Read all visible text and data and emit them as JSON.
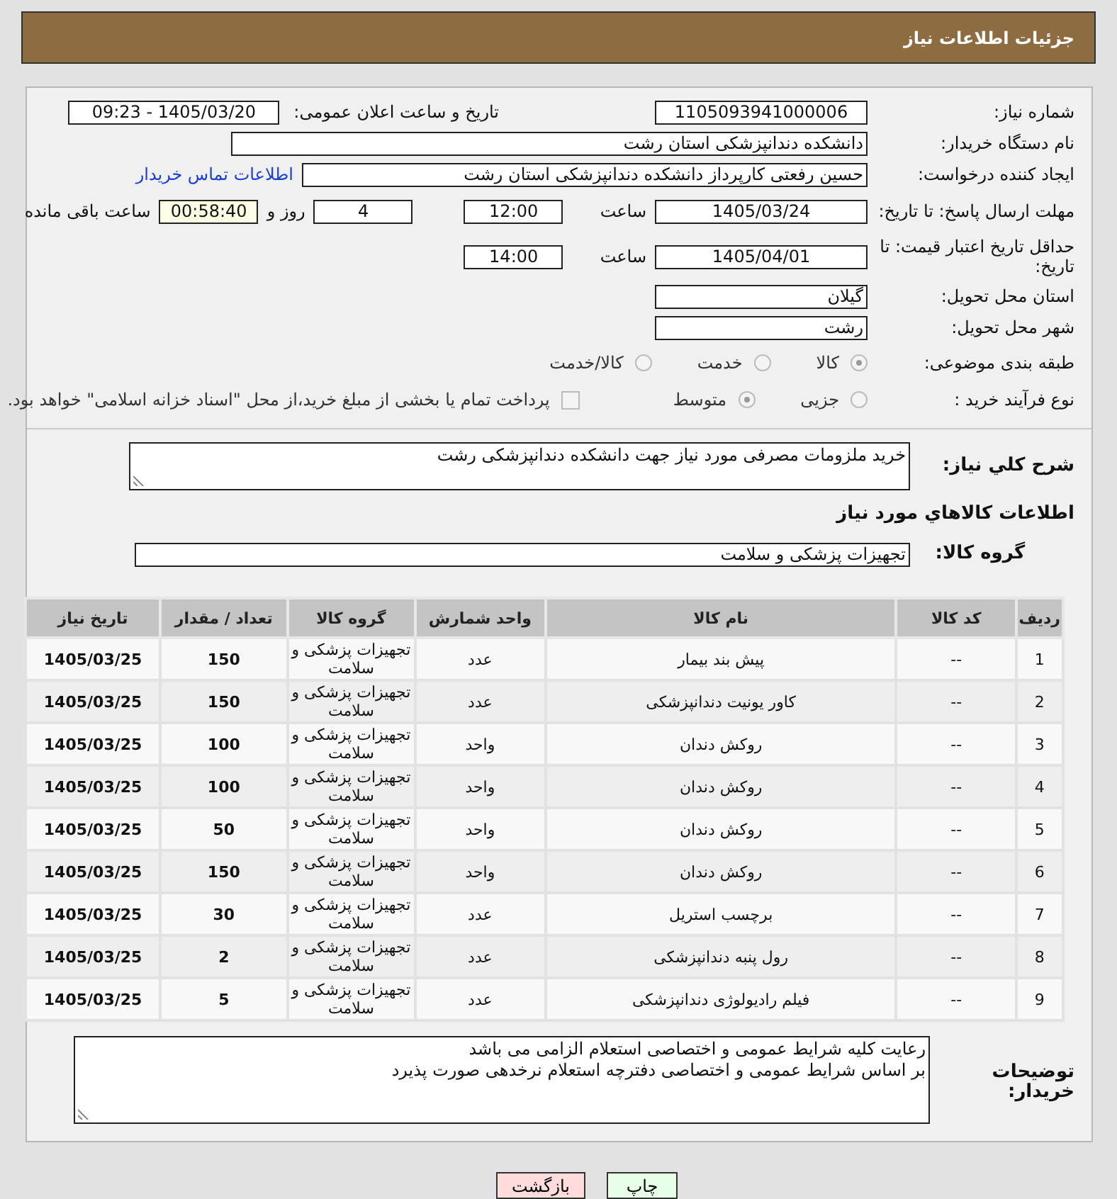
{
  "header": {
    "title": "جزئیات اطلاعات نیاز"
  },
  "need_number": {
    "label": "شماره نیاز:",
    "value": "1105093941000006"
  },
  "announce": {
    "label": "تاریخ و ساعت اعلان عمومی:",
    "value": "1405/03/20 - 09:23"
  },
  "buyer": {
    "label": "نام دستگاه خریدار:",
    "value": "دانشکده دندانپزشکی استان رشت"
  },
  "requester": {
    "label": "ایجاد کننده درخواست:",
    "value": "حسین رفعتی کارپرداز دانشکده دندانپزشکی استان رشت",
    "link": "اطلاعات تماس خریدار"
  },
  "deadline": {
    "label": "مهلت ارسال پاسخ: تا تاریخ:",
    "date": "1405/03/24",
    "time_label": "ساعت",
    "time": "12:00",
    "days": "4",
    "days_label": "روز و",
    "remaining": "00:58:40",
    "remaining_label": "ساعت باقی مانده"
  },
  "validity": {
    "label": "حداقل تاریخ اعتبار قیمت: تا تاریخ:",
    "date": "1405/04/01",
    "time_label": "ساعت",
    "time": "14:00"
  },
  "province": {
    "label": "استان محل تحویل:",
    "value": "گیلان"
  },
  "city": {
    "label": "شهر محل تحویل:",
    "value": "رشت"
  },
  "category": {
    "label": "طبقه بندی موضوعی:",
    "options": [
      {
        "label": "کالا",
        "selected": true
      },
      {
        "label": "خدمت",
        "selected": false
      },
      {
        "label": "کالا/خدمت",
        "selected": false
      }
    ]
  },
  "process": {
    "label": "نوع فرآیند خرید :",
    "options": [
      {
        "label": "جزیی",
        "selected": false
      },
      {
        "label": "متوسط",
        "selected": true
      }
    ],
    "payment": {
      "label": "پرداخت تمام یا بخشی از مبلغ خرید،از محل \"اسناد خزانه اسلامی\" خواهد بود.",
      "checked": false
    }
  },
  "description": {
    "label": "شرح کلي نياز:",
    "value": "خرید ملزومات مصرفی مورد نیاز جهت دانشکده دندانپزشکی رشت"
  },
  "goods_title": "اطلاعات کالاهاي مورد نياز",
  "group": {
    "label": "گروه کالا:",
    "value": "تجهیزات پزشکی و سلامت"
  },
  "table": {
    "columns": [
      "ردیف",
      "کد کالا",
      "نام کالا",
      "واحد شمارش",
      "گروه کالا",
      "تعداد / مقدار",
      "تاریخ نیاز"
    ],
    "rows": [
      [
        "1",
        "--",
        "پیش بند بیمار",
        "عدد",
        "تجهیزات پزشکی و سلامت",
        "150",
        "1405/03/25"
      ],
      [
        "2",
        "--",
        "کاور یونیت دندانپزشکی",
        "عدد",
        "تجهیزات پزشکی و سلامت",
        "150",
        "1405/03/25"
      ],
      [
        "3",
        "--",
        "روکش دندان",
        "واحد",
        "تجهیزات پزشکی و سلامت",
        "100",
        "1405/03/25"
      ],
      [
        "4",
        "--",
        "روکش دندان",
        "واحد",
        "تجهیزات پزشکی و سلامت",
        "100",
        "1405/03/25"
      ],
      [
        "5",
        "--",
        "روکش دندان",
        "واحد",
        "تجهیزات پزشکی و سلامت",
        "50",
        "1405/03/25"
      ],
      [
        "6",
        "--",
        "روکش دندان",
        "واحد",
        "تجهیزات پزشکی و سلامت",
        "150",
        "1405/03/25"
      ],
      [
        "7",
        "--",
        "برچسب استریل",
        "عدد",
        "تجهیزات پزشکی و سلامت",
        "30",
        "1405/03/25"
      ],
      [
        "8",
        "--",
        "رول پنبه دندانپزشکی",
        "عدد",
        "تجهیزات پزشکی و سلامت",
        "2",
        "1405/03/25"
      ],
      [
        "9",
        "--",
        "فیلم رادیولوژی دندانپزشکی",
        "عدد",
        "تجهیزات پزشکی و سلامت",
        "5",
        "1405/03/25"
      ]
    ]
  },
  "notes": {
    "label": "توضیحات خریدار:",
    "lines": [
      "رعایت کلیه شرایط عمومی و اختصاصی استعلام الزامی می باشد",
      "بر اساس شرایط عمومی و اختصاصی دفترچه استعلام نرخدهی صورت پذیرد"
    ]
  },
  "buttons": [
    {
      "label": "چاپ",
      "kind": "print"
    },
    {
      "label": "بازگشت",
      "kind": "back"
    }
  ]
}
